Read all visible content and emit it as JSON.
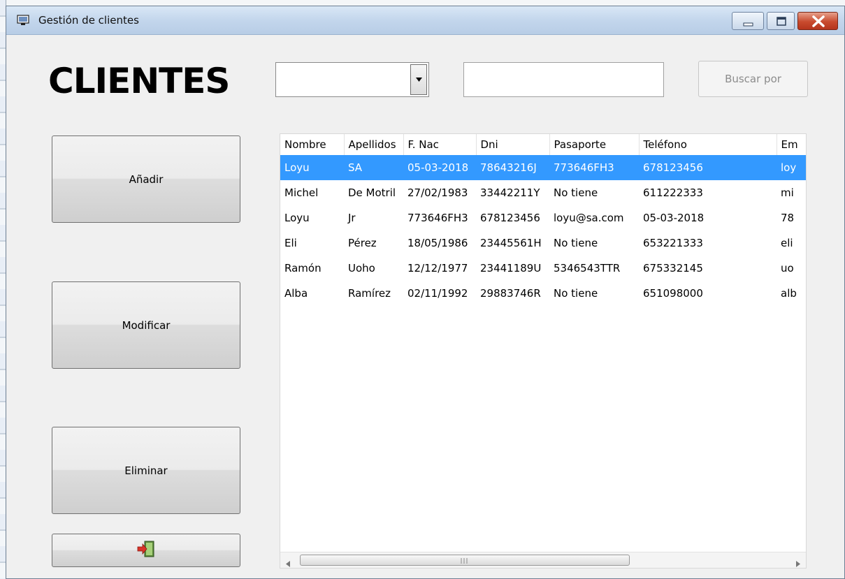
{
  "window": {
    "title": "Gestión de clientes"
  },
  "header": {
    "title": "CLIENTES"
  },
  "search": {
    "filter_selected": "",
    "query": "",
    "button_label": "Buscar por"
  },
  "actions": {
    "add_label": "Añadir",
    "modify_label": "Modificar",
    "delete_label": "Eliminar",
    "exit_icon": "exit-door-icon"
  },
  "table": {
    "columns": [
      "Nombre",
      "Apellidos",
      "F. Nac",
      "Dni",
      "Pasaporte",
      "Teléfono",
      "Em"
    ],
    "rows": [
      [
        "Loyu",
        "SA",
        "05-03-2018",
        "78643216J",
        "773646FH3",
        "678123456",
        "loy"
      ],
      [
        "Michel",
        "De Motril",
        "27/02/1983",
        "33442211Y",
        "No tiene",
        "611222333",
        "mi"
      ],
      [
        "Loyu",
        "Jr",
        "773646FH3",
        "678123456",
        "loyu@sa.com",
        "05-03-2018",
        "78"
      ],
      [
        "Eli",
        "Pérez",
        "18/05/1986",
        "23445561H",
        "No tiene",
        "653221333",
        "eli"
      ],
      [
        "Ramón",
        "Uoho",
        "12/12/1977",
        "23441189U",
        "5346543TTR",
        "675332145",
        "uo"
      ],
      [
        "Alba",
        "Ramírez",
        "02/11/1992",
        "29883746R",
        "No tiene",
        "651098000",
        "alb"
      ]
    ],
    "selected_row": 0
  },
  "colors": {
    "selection": "#3399ff",
    "close_button": "#c84a2e"
  }
}
